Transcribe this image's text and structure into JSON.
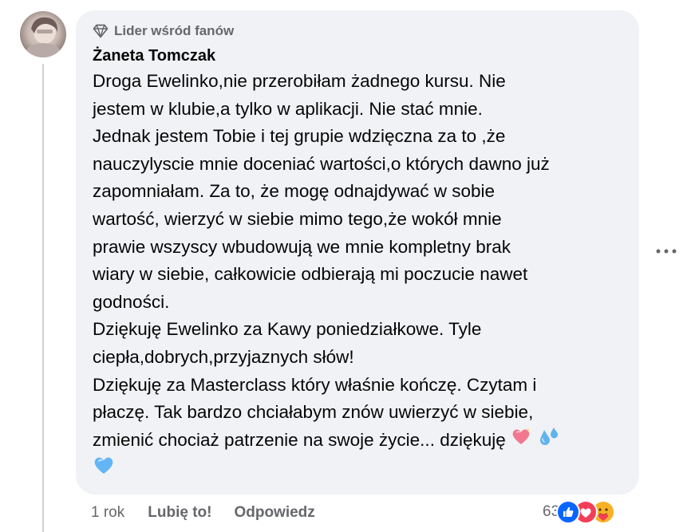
{
  "comment": {
    "badge": "Lider wśród fanów",
    "author": "Żaneta Tomczak",
    "lines": [
      "Droga Ewelinko,nie przerobiłam żadnego kursu. Nie",
      "jestem w klubie,a tylko w aplikacji. Nie stać mnie.",
      "Jednak jestem Tobie i tej grupie wdzięczna za to ,że",
      "nauczylyscie mnie doceniać wartości,o których dawno już",
      "zapomniałam. Za to, że mogę odnajdywać w sobie",
      "wartość, wierzyć w siebie mimo tego,że wokół mnie",
      "prawie wszyscy wbudowują we mnie kompletny brak",
      "wiary w siebie, całkowicie odbierają mi poczucie nawet",
      "godności.",
      "Dziękuję Ewelinko za Kawy poniedziałkowe. Tyle",
      "ciepła,dobrych,przyjaznych słów!",
      "Dziękuję za Masterclass który właśnie kończę. Czytam i",
      "płaczę. Tak bardzo chciałabym znów uwierzyć w siebie,",
      "zmienić chociaż patrzenie na swoje życie... dziękuję"
    ],
    "emojis": [
      "sparkling-heart",
      "sweat-droplets",
      "blue-heart"
    ]
  },
  "actions": {
    "time": "1 rok",
    "like": "Lubię to!",
    "reply": "Odpowiedz"
  },
  "reactions": {
    "count": "63",
    "icons": [
      "like-reaction-icon",
      "love-reaction-icon",
      "care-reaction-icon"
    ]
  },
  "colors": {
    "bubble": "#f0f2f5",
    "secondary_text": "#65676b",
    "like_blue": "#0866ff",
    "love_red": "#f33e58",
    "care_yellow": "#f7b125"
  }
}
